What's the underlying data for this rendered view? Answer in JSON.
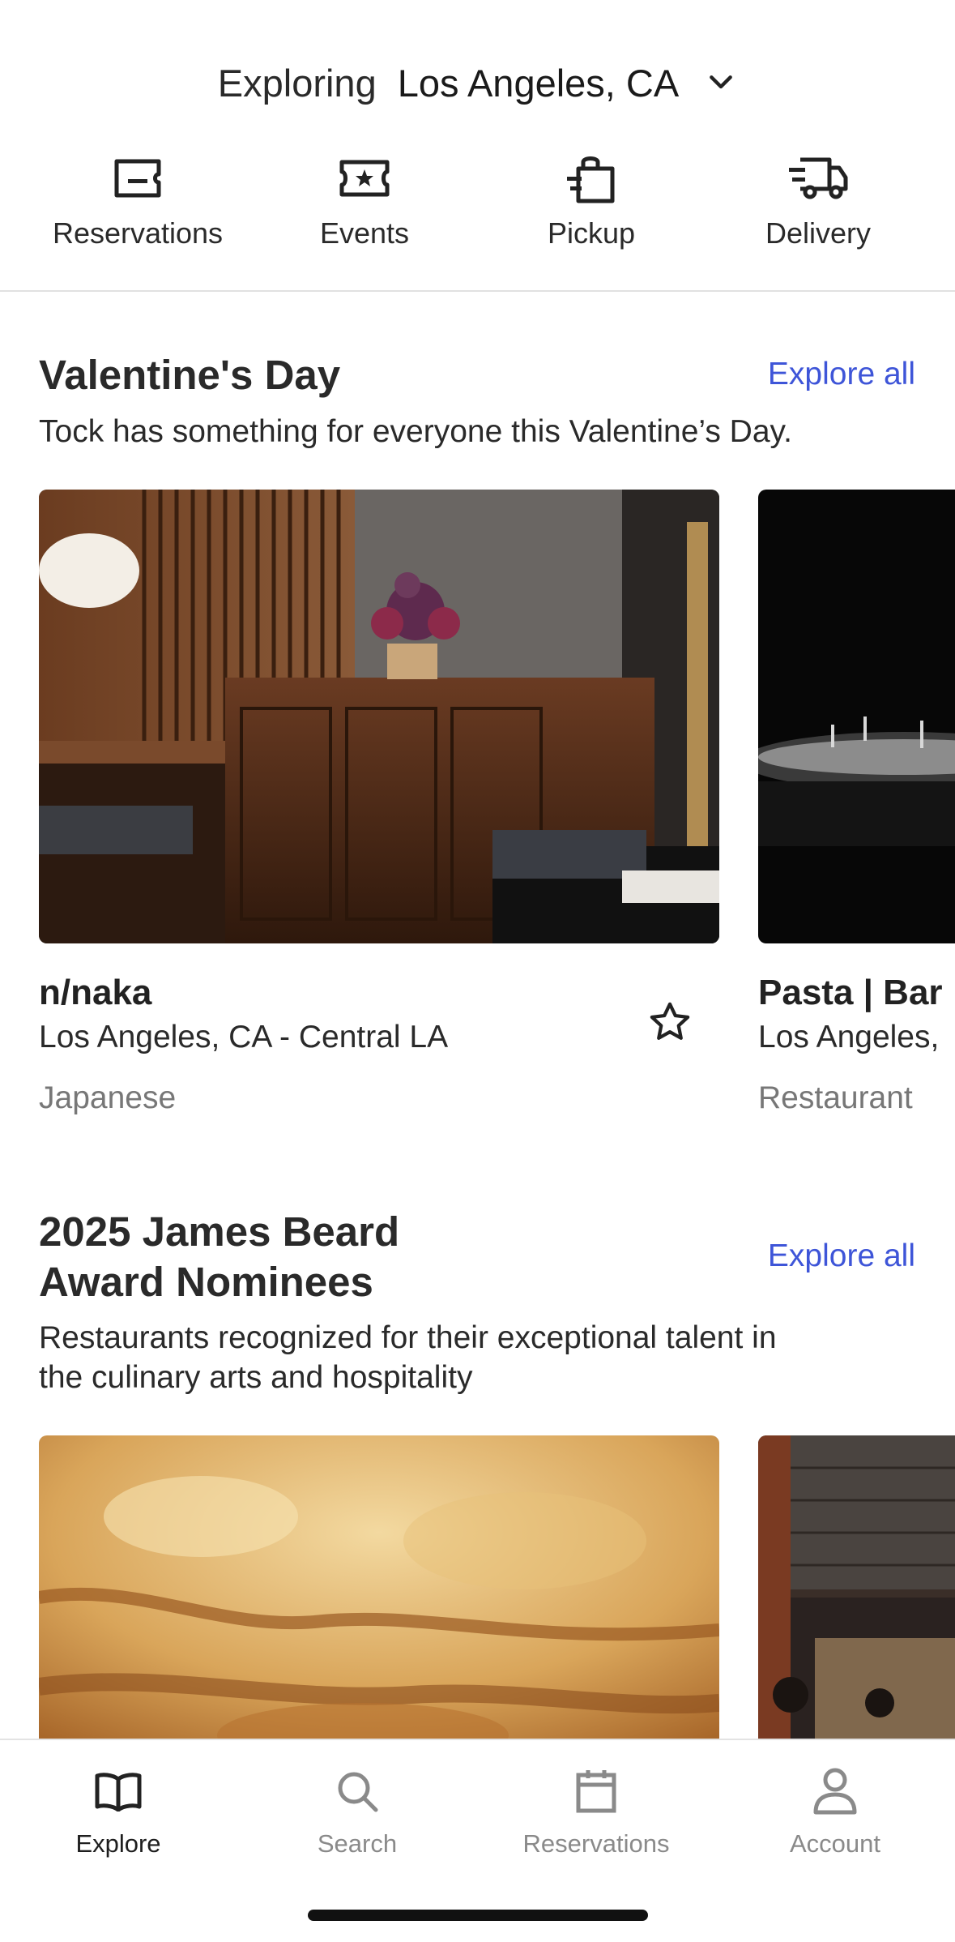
{
  "location": {
    "prefix": "Exploring",
    "city": "Los Angeles, CA",
    "dropdown_icon": "chevron-down-icon"
  },
  "categories": [
    {
      "label": "Reservations",
      "icon": "reservation-ticket-icon"
    },
    {
      "label": "Events",
      "icon": "event-star-ticket-icon"
    },
    {
      "label": "Pickup",
      "icon": "pickup-bag-icon"
    },
    {
      "label": "Delivery",
      "icon": "delivery-truck-icon"
    }
  ],
  "sections": [
    {
      "title": "Valentine's Day",
      "explore_all": "Explore all",
      "subtitle": "Tock has something for everyone this Valentine’s Day.",
      "cards": [
        {
          "name": "n/naka",
          "location": "Los Angeles, CA - Central LA",
          "cuisine": "Japanese"
        },
        {
          "name": "Pasta | Bar",
          "location": "Los Angeles,",
          "cuisine": "Restaurant"
        }
      ]
    },
    {
      "title_line1": "2025 James Beard",
      "title_line2": "Award Nominees",
      "explore_all": "Explore all",
      "subtitle_line1": "Restaurants recognized for their exceptional talent in",
      "subtitle_line2": "the culinary arts and hospitality"
    }
  ],
  "bottom_nav": [
    {
      "label": "Explore",
      "icon": "book-icon",
      "active": true
    },
    {
      "label": "Search",
      "icon": "search-icon",
      "active": false
    },
    {
      "label": "Reservations",
      "icon": "calendar-icon",
      "active": false
    },
    {
      "label": "Account",
      "icon": "person-icon",
      "active": false
    }
  ],
  "colors": {
    "accent": "#3e55d8",
    "text": "#2a2a2a",
    "muted": "#777777"
  }
}
